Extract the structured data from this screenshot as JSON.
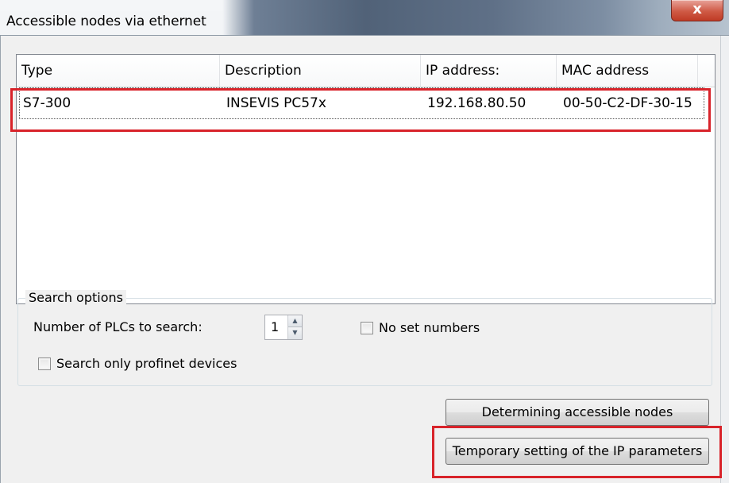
{
  "window": {
    "title": "Accessible nodes via ethernet",
    "close_glyph": "x"
  },
  "list": {
    "columns": [
      "Type",
      "Description",
      "IP address:",
      "MAC address"
    ],
    "rows": [
      [
        "S7-300",
        "INSEVIS PC57x",
        "192.168.80.50",
        "00-50-C2-DF-30-15"
      ]
    ]
  },
  "search_options": {
    "legend": "Search options",
    "plc_count_label": "Number of PLCs to search:",
    "plc_count_value": "1",
    "no_set_numbers_label": "No set numbers",
    "no_set_numbers_checked": false,
    "profinet_only_label": "Search only profinet devices",
    "profinet_only_checked": false
  },
  "buttons": {
    "determine": "Determining accessible nodes",
    "temp_ip": "Temporary setting of the IP parameters"
  },
  "icons": {
    "spin_up": "arrow-up-icon",
    "spin_down": "arrow-down-icon",
    "close": "close-icon"
  },
  "colors": {
    "highlight": "#d8232a"
  }
}
